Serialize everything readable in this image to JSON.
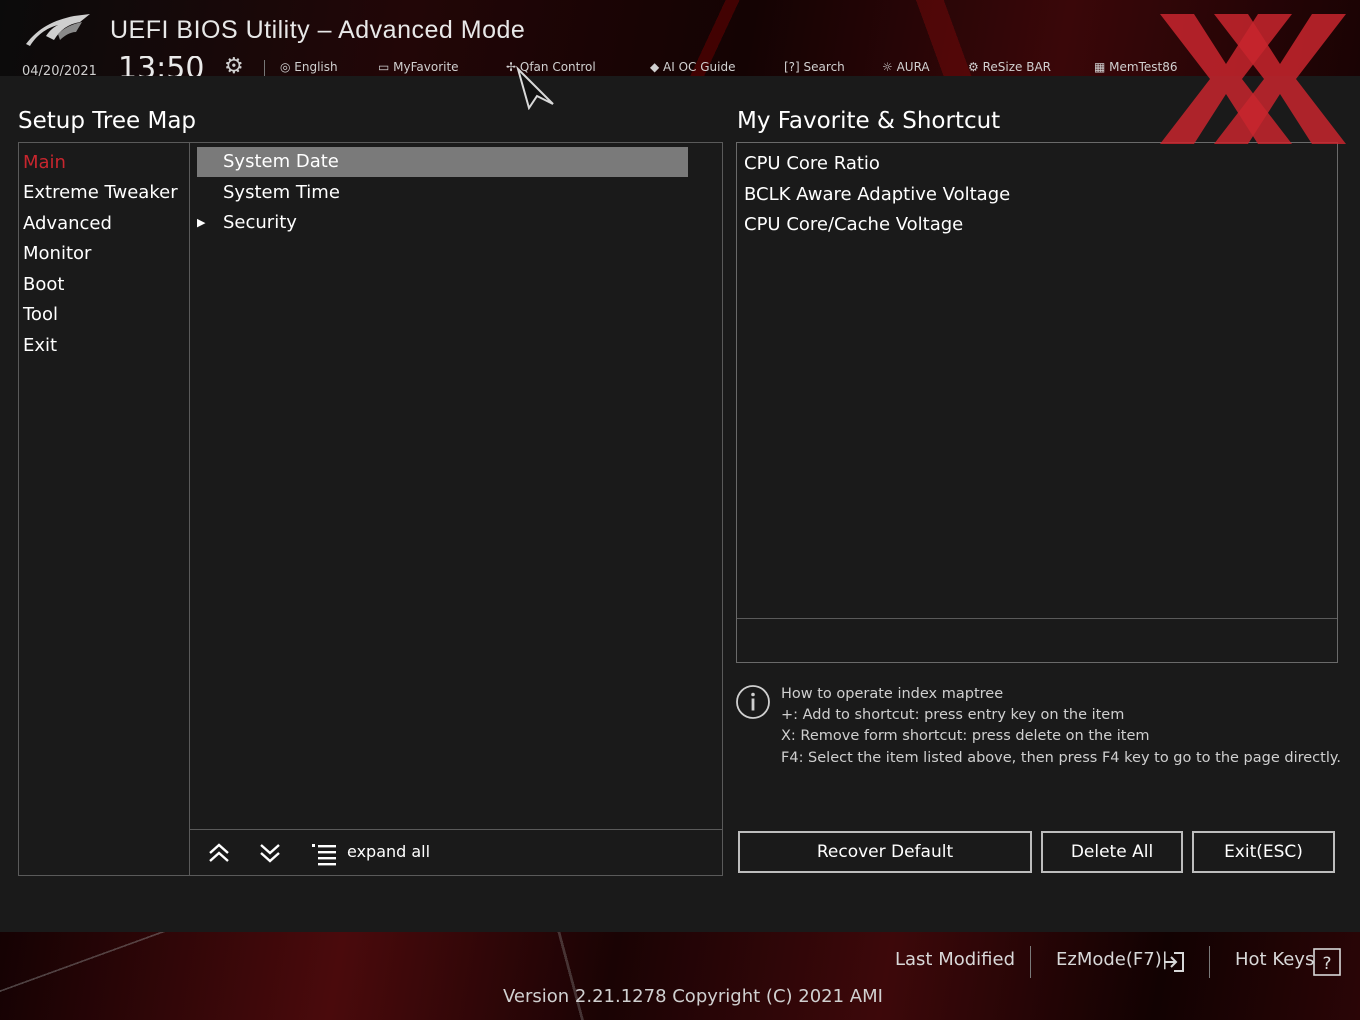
{
  "header": {
    "title": "UEFI BIOS Utility – Advanced Mode",
    "date": "04/20/2021",
    "time": "13:50",
    "status_items": [
      "English",
      "MyFavorite",
      "Qfan Control",
      "AI OC Guide",
      "Search",
      "AURA",
      "ReSize BAR",
      "MemTest86"
    ]
  },
  "tree": {
    "title": "Setup Tree Map",
    "categories": [
      "Main",
      "Extreme Tweaker",
      "Advanced",
      "Monitor",
      "Boot",
      "Tool",
      "Exit"
    ],
    "active_category": "Main",
    "items": [
      "System Date",
      "System Time",
      "Security"
    ],
    "expand_all_label": "expand all"
  },
  "favorites": {
    "title": "My Favorite & Shortcut",
    "items": [
      "CPU Core Ratio",
      "BCLK Aware Adaptive Voltage",
      "CPU Core/Cache Voltage"
    ]
  },
  "help": {
    "lines": [
      "How to operate index maptree",
      "+: Add to shortcut: press entry key on the item",
      "X: Remove form shortcut: press delete on the item",
      "F4: Select the item listed above, then press F4 key to go to the page directly."
    ]
  },
  "buttons": {
    "recover_default": "Recover Default",
    "delete_all": "Delete All",
    "exit": "Exit(ESC)"
  },
  "footer": {
    "last_modified": "Last Modified",
    "ezmode": "EzMode(F7)|",
    "hot_keys": "Hot Keys",
    "version": "Version 2.21.1278 Copyright (C) 2021 AMI"
  },
  "colors": {
    "accent_red": "#c8262e",
    "selected_row": "#7a7a7a",
    "border": "#5a5a5a",
    "background": "#1a1a1a"
  },
  "icons": [
    "rog-logo-icon",
    "gear-icon",
    "globe-icon",
    "favorite-icon",
    "fan-icon",
    "ai-oc-icon",
    "search-icon",
    "aura-icon",
    "resize-bar-icon",
    "memtest-icon",
    "info-icon",
    "collapse-all-icon",
    "expand-down-icon",
    "list-icon",
    "ezmode-exit-icon",
    "help-question-icon",
    "cursor-icon",
    "watermark-xx"
  ]
}
